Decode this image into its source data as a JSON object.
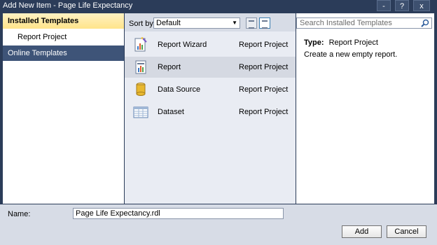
{
  "window": {
    "title": "Add New Item - Page Life Expectancy",
    "controls": [
      "-",
      "?",
      "x"
    ]
  },
  "left": {
    "installed_label": "Installed Templates",
    "installed_sub": "Report Project",
    "online_label": "Online Templates"
  },
  "toolbar": {
    "sort_label": "Sort by:",
    "sort_value": "Default"
  },
  "templates": [
    {
      "name": "Report Wizard",
      "category": "Report Project",
      "icon": "report-wizard-icon"
    },
    {
      "name": "Report",
      "category": "Report Project",
      "icon": "report-icon"
    },
    {
      "name": "Data Source",
      "category": "Report Project",
      "icon": "data-source-icon"
    },
    {
      "name": "Dataset",
      "category": "Report Project",
      "icon": "dataset-icon"
    }
  ],
  "selected_template": "Report",
  "search": {
    "placeholder": "Search Installed Templates"
  },
  "details": {
    "type_label": "Type:",
    "type_value": "Report Project",
    "description": "Create a new empty report."
  },
  "footer": {
    "name_label": "Name:",
    "name_value": "Page Life Expectancy.rdl",
    "add_label": "Add",
    "cancel_label": "Cancel"
  }
}
